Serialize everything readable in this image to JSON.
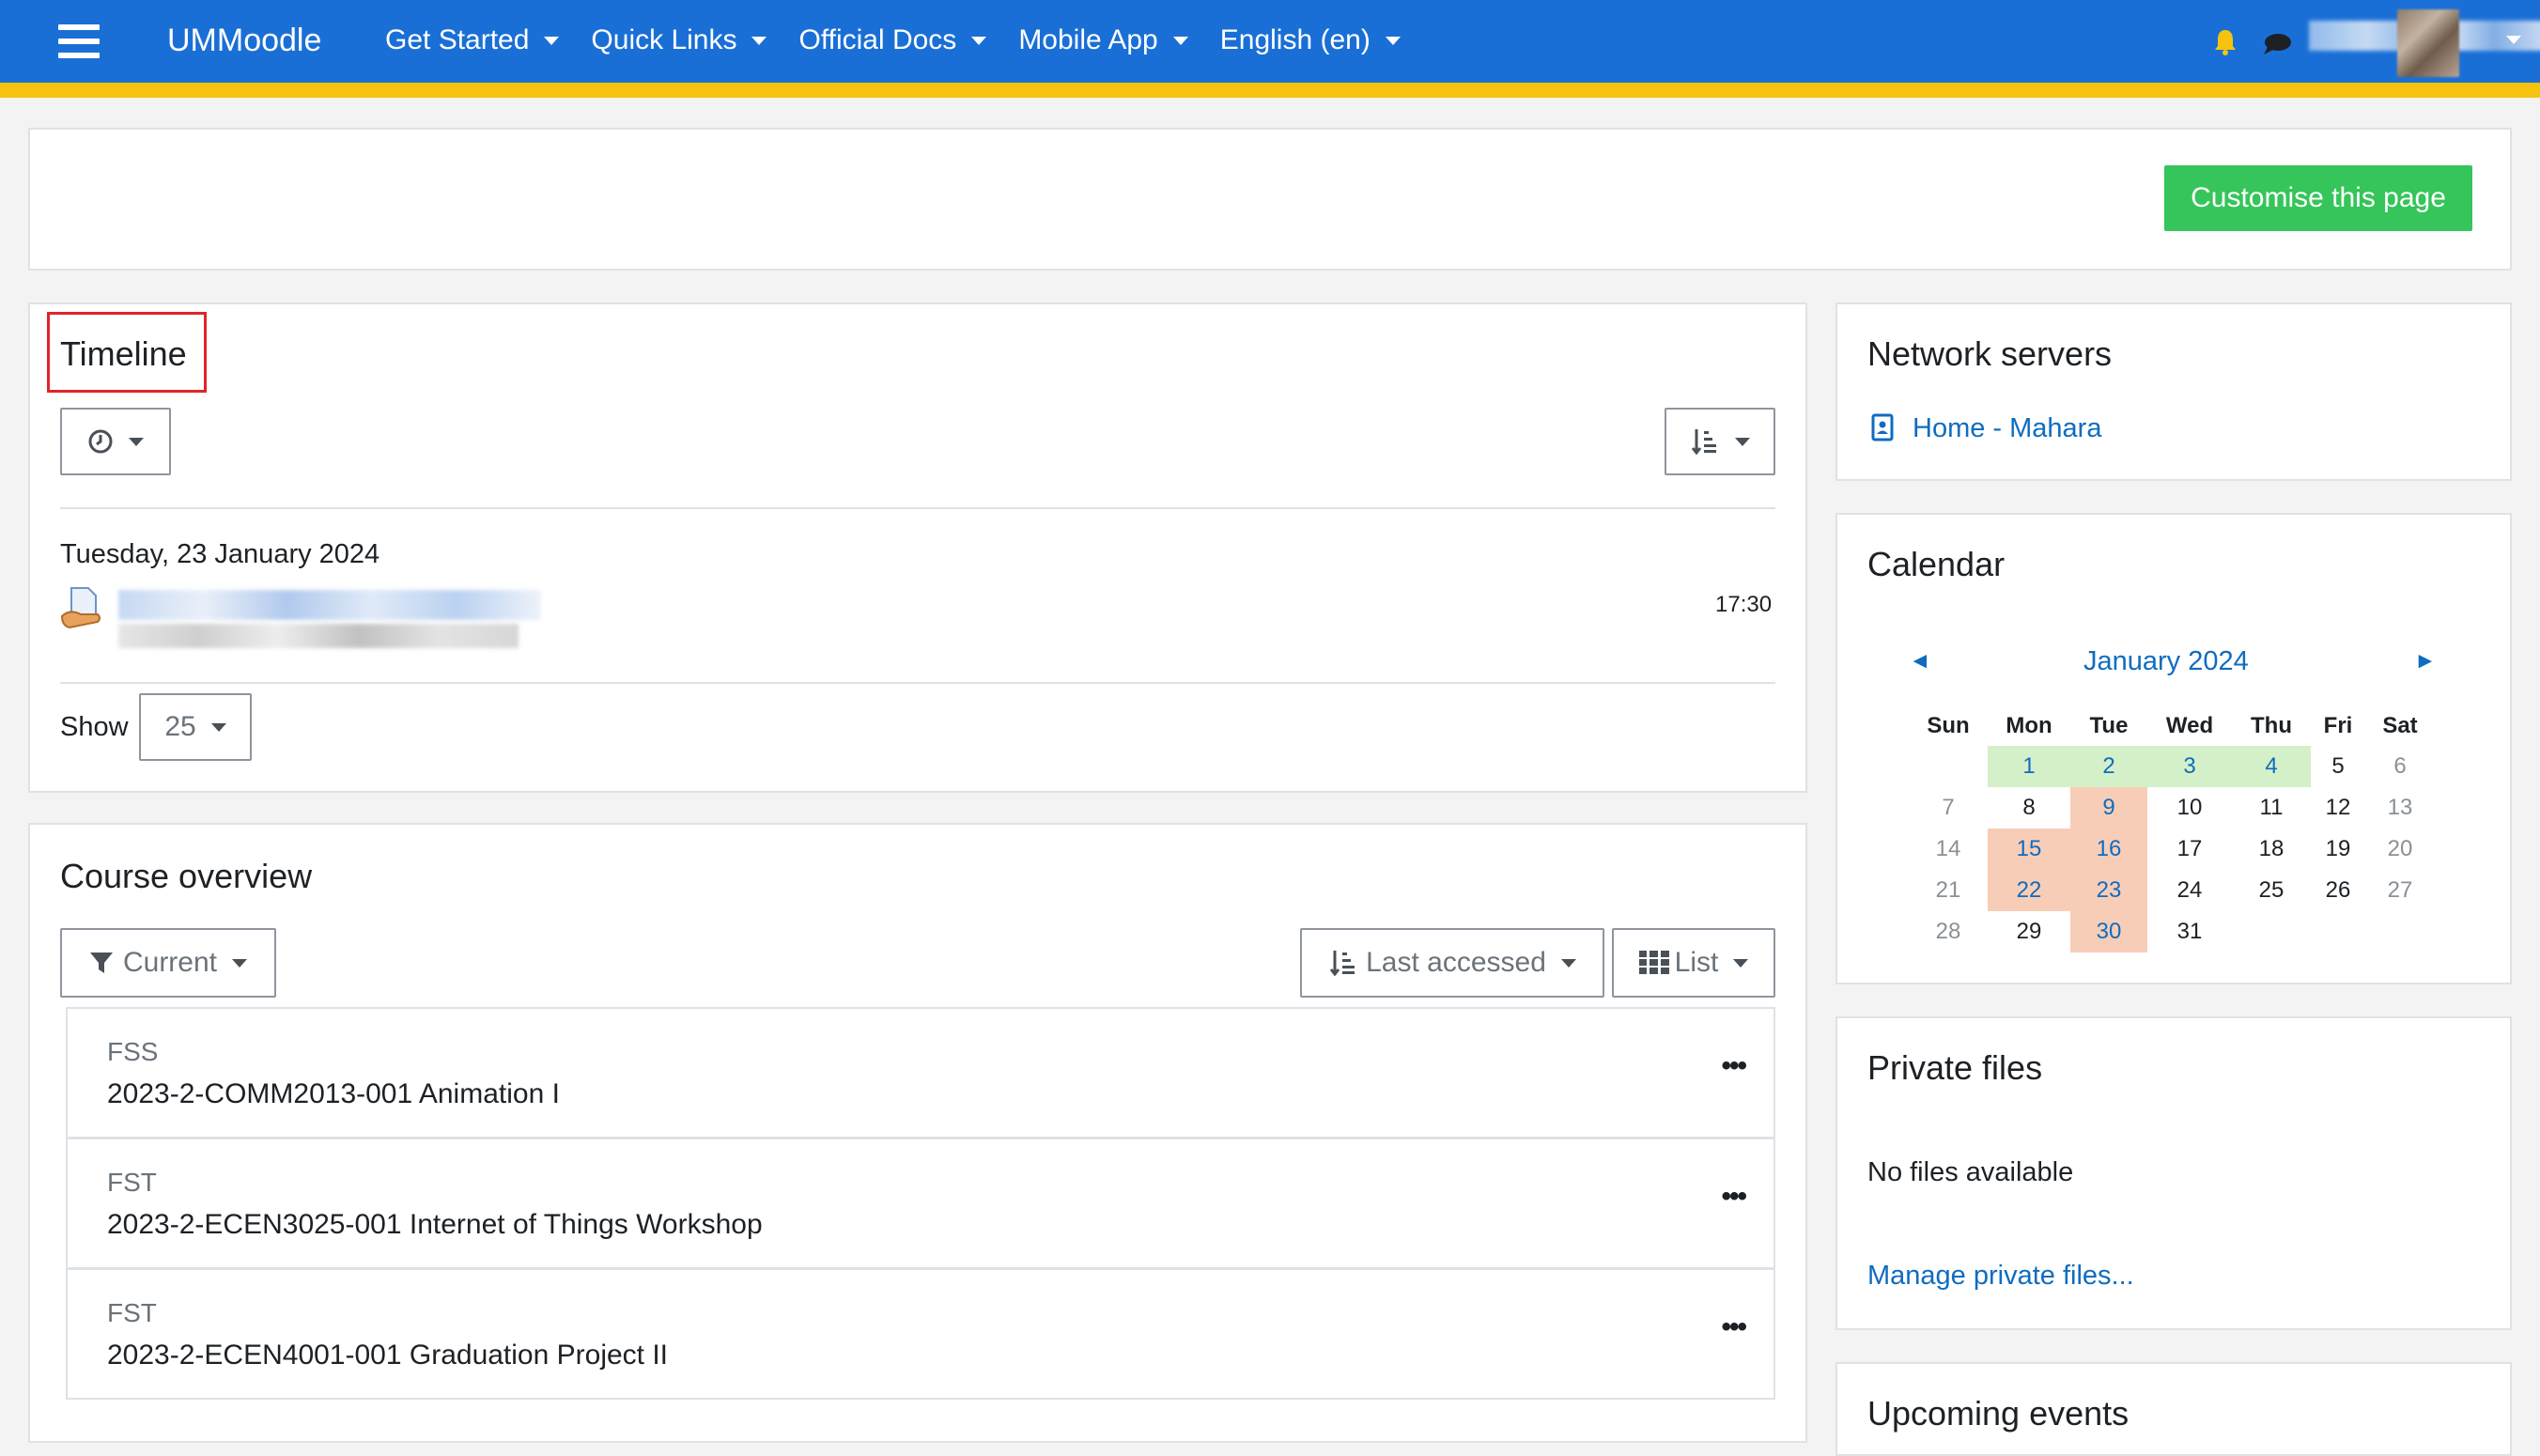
{
  "navbar": {
    "brand": "UMMoodle",
    "items": [
      {
        "label": "Get Started"
      },
      {
        "label": "Quick Links"
      },
      {
        "label": "Official Docs"
      },
      {
        "label": "Mobile App"
      },
      {
        "label": "English (en)"
      }
    ],
    "colors": {
      "bar": "#1a6fd6",
      "accent": "#f6c30f"
    }
  },
  "header": {
    "customise_label": "Customise this page"
  },
  "timeline": {
    "title": "Timeline",
    "date_heading": "Tuesday, 23 January 2024",
    "event_time": "17:30",
    "show_label": "Show",
    "show_value": "25"
  },
  "course_overview": {
    "title": "Course overview",
    "filter_label": "Current",
    "sort_label": "Last accessed",
    "view_label": "List",
    "courses": [
      {
        "category": "FSS",
        "name": "2023-2-COMM2013-001 Animation I"
      },
      {
        "category": "FST",
        "name": "2023-2-ECEN3025-001 Internet of Things Workshop"
      },
      {
        "category": "FST",
        "name": "2023-2-ECEN4001-001 Graduation Project II"
      }
    ]
  },
  "network_servers": {
    "title": "Network servers",
    "link_label": "Home - Mahara"
  },
  "calendar": {
    "title": "Calendar",
    "month": "January 2024",
    "prev_glyph": "◄",
    "next_glyph": "►",
    "weekdays": [
      "Sun",
      "Mon",
      "Tue",
      "Wed",
      "Thu",
      "Fri",
      "Sat"
    ],
    "weeks": [
      [
        "",
        "1",
        "2",
        "3",
        "4",
        "5",
        "6"
      ],
      [
        "7",
        "8",
        "9",
        "10",
        "11",
        "12",
        "13"
      ],
      [
        "14",
        "15",
        "16",
        "17",
        "18",
        "19",
        "20"
      ],
      [
        "21",
        "22",
        "23",
        "24",
        "25",
        "26",
        "27"
      ],
      [
        "28",
        "29",
        "30",
        "31",
        "",
        "",
        ""
      ]
    ],
    "highlight_colors": {
      "holiday": "#d4f0c8",
      "event": "#f8cdb8"
    }
  },
  "private_files": {
    "title": "Private files",
    "empty_text": "No files available",
    "manage_link": "Manage private files..."
  },
  "upcoming_events": {
    "title": "Upcoming events"
  }
}
